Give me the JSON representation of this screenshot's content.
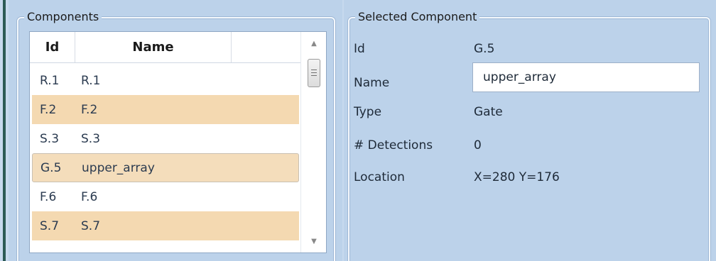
{
  "components": {
    "title": "Components",
    "columns": {
      "id": "Id",
      "name": "Name"
    },
    "rows": [
      {
        "id": "R.1",
        "name": "R.1",
        "style": "plain"
      },
      {
        "id": "F.2",
        "name": "F.2",
        "style": "alt"
      },
      {
        "id": "S.3",
        "name": "S.3",
        "style": "plain"
      },
      {
        "id": "G.5",
        "name": "upper_array",
        "style": "selected"
      },
      {
        "id": "F.6",
        "name": "F.6",
        "style": "plain"
      },
      {
        "id": "S.7",
        "name": "S.7",
        "style": "alt"
      }
    ]
  },
  "selected": {
    "title": "Selected Component",
    "id_label": "Id",
    "id_value": "G.5",
    "name_label": "Name",
    "name_value": "upper_array",
    "type_label": "Type",
    "type_value": "Gate",
    "detections_label": "# Detections",
    "detections_value": "0",
    "location_label": "Location",
    "location_value": "X=280 Y=176"
  },
  "icons": {
    "scroll_up": "triangle-up-icon",
    "scroll_down": "triangle-down-icon"
  },
  "colors": {
    "panel": "#bcd2ea",
    "row_highlight": "#f4d9b1",
    "left_bar": "#2c5a55"
  }
}
